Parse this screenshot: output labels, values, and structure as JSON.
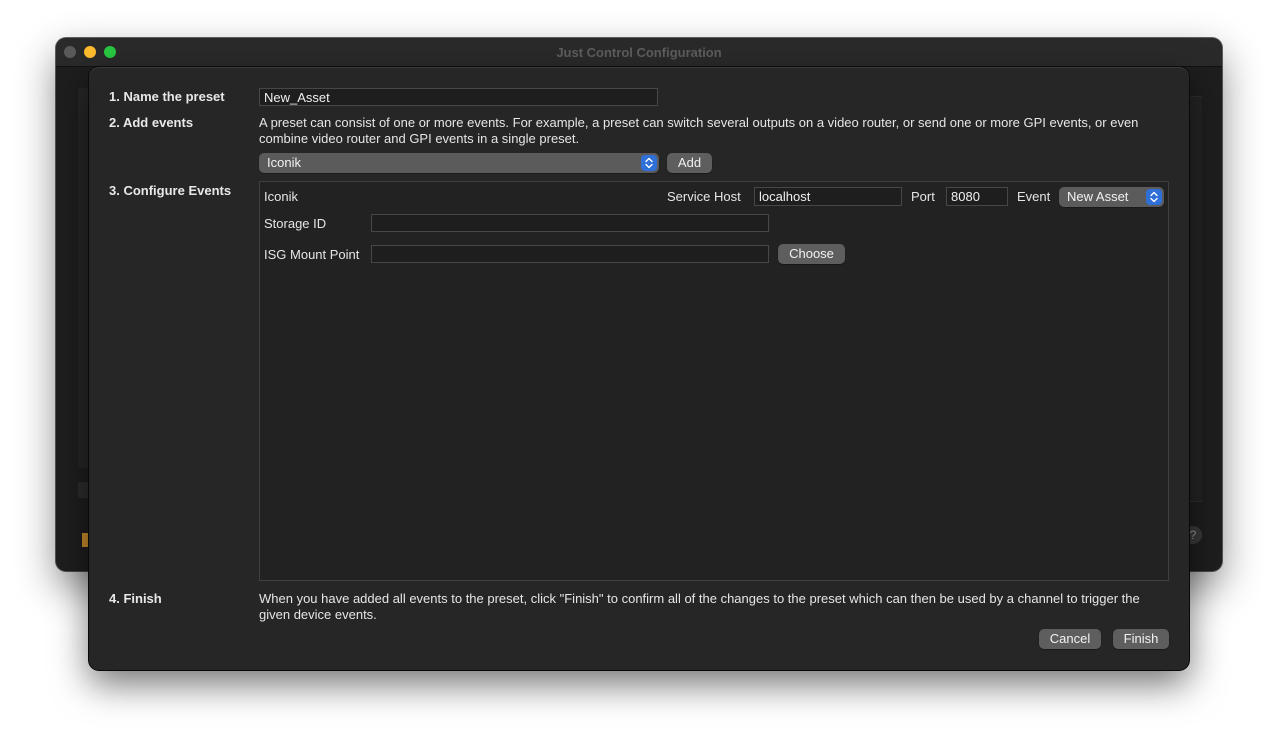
{
  "window": {
    "title": "Just Control Configuration",
    "help_glyph": "?"
  },
  "steps": {
    "name": {
      "label": "1. Name the preset",
      "value": "New_Asset"
    },
    "add": {
      "label": "2. Add events",
      "description": "A preset can consist of one or more events. For example, a preset can switch several outputs on a video router, or send one or more GPI events, or even combine video router and GPI events in a single preset.",
      "selected_type": "Iconik",
      "add_button": "Add"
    },
    "configure": {
      "label": "3. Configure Events",
      "event_name": "Iconik",
      "service_host_label": "Service Host",
      "service_host_value": "localhost",
      "port_label": "Port",
      "port_value": "8080",
      "event_label": "Event",
      "event_value": "New Asset",
      "storage_id_label": "Storage ID",
      "storage_id_value": "",
      "mount_point_label": "ISG Mount Point",
      "mount_point_value": "",
      "choose_button": "Choose"
    },
    "finish": {
      "label": "4. Finish",
      "description": "When you have added all events to the preset, click \"Finish\" to confirm all of the changes to the preset which can then be used by a channel to trigger the given device events.",
      "cancel_button": "Cancel",
      "finish_button": "Finish"
    }
  },
  "colors": {
    "accent": "#2f6fd8",
    "close": "#5a5a5a",
    "minimize": "#febc2e",
    "maximize": "#28c840"
  }
}
